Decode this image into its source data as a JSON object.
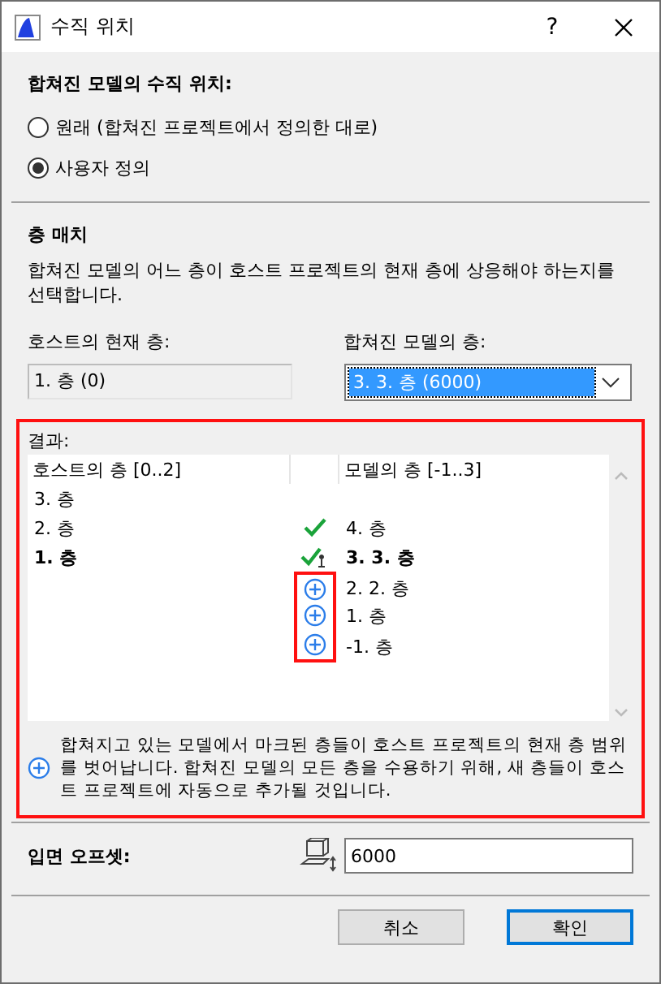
{
  "window": {
    "title": "수직 위치",
    "help": "?"
  },
  "position": {
    "heading": "합쳐진 모델의 수직 위치:",
    "options": [
      {
        "label": "원래 (합쳐진 프로젝트에서 정의한 대로)",
        "selected": false
      },
      {
        "label": "사용자 정의",
        "selected": true
      }
    ]
  },
  "story_match": {
    "heading": "층 매치",
    "description": "합쳐진 모델의 어느 층이 호스트 프로젝트의 현재 층에 상응해야 하는지를 선택합니다.",
    "host_label": "호스트의 현재 층:",
    "host_value": "1. 층 (0)",
    "model_label": "합쳐진 모델의 층:",
    "model_value": "3. 3. 층 (6000)"
  },
  "result": {
    "label": "결과:",
    "columns": [
      "호스트의 층 [0..2]",
      "모델의 층 [-1..3]"
    ],
    "rows": [
      {
        "host": "3. 층",
        "kind": "none",
        "model": "",
        "bold": false
      },
      {
        "host": "2. 층",
        "kind": "check",
        "model": "4. 층",
        "bold": false
      },
      {
        "host": "1. 층",
        "kind": "anchor",
        "model": "3. 3. 층",
        "bold": true
      },
      {
        "host": "",
        "kind": "add",
        "model": "2. 2. 층",
        "bold": false
      },
      {
        "host": "",
        "kind": "add",
        "model": "1. 층",
        "bold": false
      },
      {
        "host": "",
        "kind": "add",
        "model": "-1. 층",
        "bold": false
      }
    ],
    "note": "합쳐지고 있는 모델에서 마크된 층들이 호스트 프로젝트의 현재 층 범위를 벗어납니다. 합쳐진 모델의 모든 층을 수용하기 위해, 새 층들이 호스트 프로젝트에 자동으로 추가될 것입니다."
  },
  "offset": {
    "label": "입면 오프셋:",
    "value": "6000"
  },
  "buttons": [
    {
      "label": "취소",
      "default": false
    },
    {
      "label": "확인",
      "default": true
    }
  ]
}
